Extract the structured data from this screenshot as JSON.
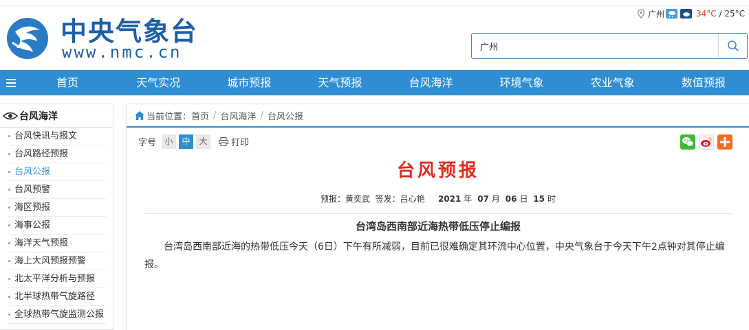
{
  "header": {
    "logo_cn": "中央气象台",
    "logo_en": "www.nmc.cn",
    "weather": {
      "city": "广州",
      "temp_high": "34°C",
      "sep": " / ",
      "temp_low": "25°C"
    },
    "search": {
      "value": "广州",
      "placeholder": ""
    }
  },
  "nav": {
    "items": [
      "首页",
      "天气实况",
      "城市预报",
      "天气预报",
      "台风海洋",
      "环境气象",
      "农业气象",
      "数值预报"
    ]
  },
  "sidebar": {
    "title": "台风海洋",
    "items": [
      "台风快讯与报文",
      "台风路径预报",
      "台风公报",
      "台风预警",
      "海区预报",
      "海事公报",
      "海洋天气预报",
      "海上大风预报预警",
      "北太平洋分析与预报",
      "北半球热带气旋路径",
      "全球热带气旋监测公报"
    ],
    "active_index": 2
  },
  "breadcrumb": {
    "prefix": "当前位置：",
    "items": [
      "首页",
      "台风海洋",
      "台风公报"
    ]
  },
  "tools": {
    "font_label": "字号",
    "small": "小",
    "medium": "中",
    "large": "大",
    "print": "打印"
  },
  "article": {
    "title": "台风预报",
    "meta": {
      "forecaster_label": "预报：",
      "forecaster": "黄奕武",
      "issuer_label": "签发：",
      "issuer": "吕心艳",
      "year": "2021",
      "year_unit": "年",
      "month": "07",
      "month_unit": "月",
      "day": "06",
      "day_unit": "日",
      "hour": "15",
      "hour_unit": "时"
    },
    "subtitle": "台湾岛西南部近海热带低压停止编报",
    "body": "台湾岛西南部近海的热带低压今天（6日）下午有所减弱，目前已很难确定其环流中心位置，中央气象台于今天下午2点钟对其停止编报。"
  },
  "colors": {
    "brand": "#1e5fa8",
    "nav": "#2f8ed3",
    "title": "#e02c20",
    "active": "#3a96d8"
  }
}
